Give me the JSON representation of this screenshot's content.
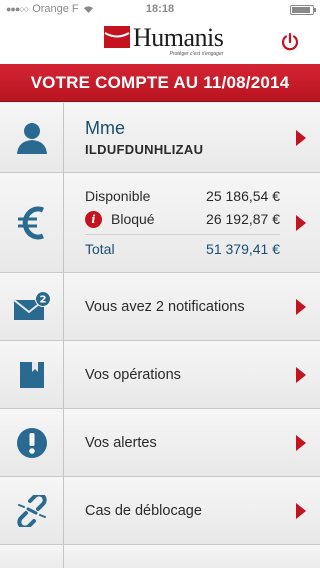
{
  "status_bar": {
    "signal": "●●●○○",
    "carrier": "Orange F",
    "time": "18:18"
  },
  "header": {
    "logo_name": "Humanis",
    "logo_tagline": "Protéger c'est s'engager"
  },
  "title_bar": "VOTRE COMPTE AU 11/08/2014",
  "account": {
    "title": "Mme",
    "name": "ILDUFDUNHLIZAU"
  },
  "balances": {
    "available_label": "Disponible",
    "available_value": "25 186,54 €",
    "blocked_label": "Bloqué",
    "blocked_value": "26 192,87 €",
    "info_glyph": "i",
    "total_label": "Total",
    "total_value": "51 379,41 €"
  },
  "menu": {
    "notifications_label": "Vous avez 2 notifications",
    "notifications_badge": "2",
    "operations_label": "Vos opérations",
    "alerts_label": "Vos alertes",
    "unblocking_label": "Cas de déblocage"
  },
  "colors": {
    "brand_red": "#c4121f",
    "brand_blue": "#1b4e6e",
    "icon_blue": "#2a6a90"
  },
  "icons": [
    "person-icon",
    "euro-icon",
    "mail-icon",
    "book-icon",
    "alert-icon",
    "broken-link-icon",
    "power-icon",
    "info-icon"
  ]
}
